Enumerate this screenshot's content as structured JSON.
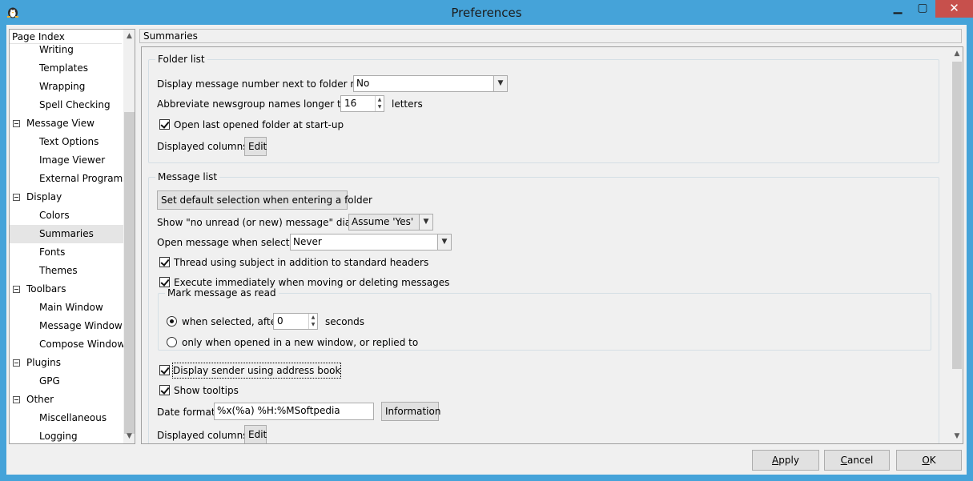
{
  "window": {
    "title": "Preferences",
    "close_glyph": "✕",
    "min_glyph": "▁",
    "max_glyph": "▢"
  },
  "tree": {
    "header": "Page Index",
    "items": [
      {
        "label": "Writing",
        "kind": "child"
      },
      {
        "label": "Templates",
        "kind": "child"
      },
      {
        "label": "Wrapping",
        "kind": "child"
      },
      {
        "label": "Spell Checking",
        "kind": "child"
      },
      {
        "label": "Message View",
        "kind": "group"
      },
      {
        "label": "Text Options",
        "kind": "child"
      },
      {
        "label": "Image Viewer",
        "kind": "child"
      },
      {
        "label": "External Programs",
        "kind": "child"
      },
      {
        "label": "Display",
        "kind": "group"
      },
      {
        "label": "Colors",
        "kind": "child"
      },
      {
        "label": "Summaries",
        "kind": "child",
        "selected": true
      },
      {
        "label": "Fonts",
        "kind": "child"
      },
      {
        "label": "Themes",
        "kind": "child"
      },
      {
        "label": "Toolbars",
        "kind": "group"
      },
      {
        "label": "Main Window",
        "kind": "child"
      },
      {
        "label": "Message Window",
        "kind": "child"
      },
      {
        "label": "Compose Window",
        "kind": "child"
      },
      {
        "label": "Plugins",
        "kind": "group"
      },
      {
        "label": "GPG",
        "kind": "child"
      },
      {
        "label": "Other",
        "kind": "group"
      },
      {
        "label": "Miscellaneous",
        "kind": "child"
      },
      {
        "label": "Logging",
        "kind": "child"
      }
    ]
  },
  "section_title": "Summaries",
  "folder_list": {
    "legend": "Folder list",
    "msgnum_label": "Display message number next to folder name",
    "msgnum_value": "No",
    "abbrev_label": "Abbreviate newsgroup names longer than",
    "abbrev_value": "16",
    "abbrev_unit": "letters",
    "open_last_label": "Open last opened folder at start-up",
    "open_last_checked": true,
    "columns_label": "Displayed columns",
    "columns_button": "Edit"
  },
  "message_list": {
    "legend": "Message list",
    "default_sel_button": "Set default selection when entering a folder",
    "no_unread_label": "Show \"no unread (or new) message\" dialog",
    "no_unread_value": "Assume 'Yes'",
    "open_when_label": "Open message when selected",
    "open_when_value": "Never",
    "thread_label": "Thread using subject in addition to standard headers",
    "thread_checked": true,
    "execute_label": "Execute immediately when moving or deleting messages",
    "execute_checked": true,
    "mark_read": {
      "legend": "Mark message as read",
      "when_selected_label": "when selected, after",
      "when_selected_value": "0",
      "seconds_label": "seconds",
      "only_when_label": "only when opened in a new window, or replied to"
    },
    "sender_label": "Display sender using address book",
    "sender_checked": true,
    "tooltips_label": "Show tooltips",
    "tooltips_checked": true,
    "date_format_label": "Date format",
    "date_format_value": "%x(%a) %H:%MSoftpedia",
    "information_button": "Information",
    "columns_label": "Displayed columns",
    "columns_button": "Edit"
  },
  "footer": {
    "apply": "Apply",
    "cancel": "Cancel",
    "ok": "OK"
  }
}
